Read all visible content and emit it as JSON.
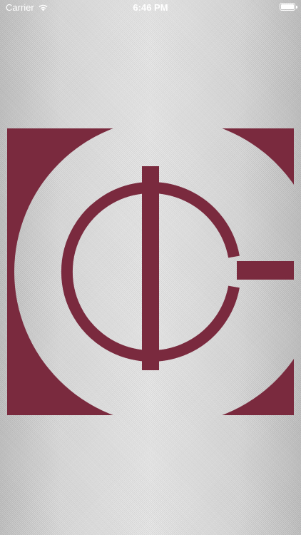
{
  "status_bar": {
    "carrier": "Carrier",
    "time": "6:46 PM",
    "icons": {
      "wifi": "wifi-icon",
      "battery": "battery-icon"
    },
    "battery_level": 1.0
  },
  "splash": {
    "logo_icon": "company-logo-icon",
    "colors": {
      "brand": "#7a2a3e",
      "background": "#d9d9d9",
      "status_text": "#ffffff"
    }
  }
}
